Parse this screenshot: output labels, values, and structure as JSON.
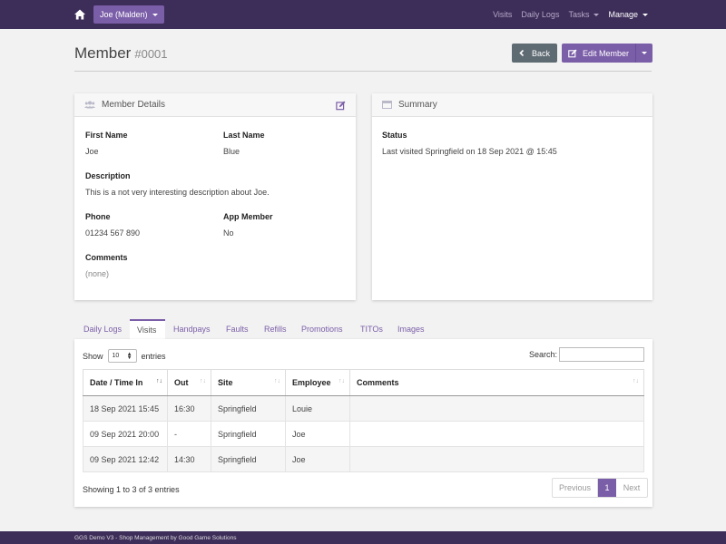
{
  "navbar": {
    "store_label": "Joe (Malden)",
    "links": [
      {
        "label": "Visits"
      },
      {
        "label": "Daily Logs"
      },
      {
        "label": "Tasks"
      },
      {
        "label": "Manage"
      }
    ]
  },
  "header": {
    "title": "Member",
    "id": "#0001",
    "back_label": "Back",
    "edit_label": "Edit Member"
  },
  "member_details": {
    "title": "Member Details",
    "first_name_label": "First Name",
    "first_name": "Joe",
    "last_name_label": "Last Name",
    "last_name": "Blue",
    "description_label": "Description",
    "description": "This is a not very interesting description about Joe.",
    "phone_label": "Phone",
    "phone": "01234 567 890",
    "app_member_label": "App Member",
    "app_member": "No",
    "comments_label": "Comments",
    "comments": "(none)"
  },
  "summary": {
    "title": "Summary",
    "status_label": "Status",
    "status": "Last visited Springfield on 18 Sep 2021 @ 15:45"
  },
  "tabs": [
    "Daily Logs",
    "Visits",
    "Handpays",
    "Faults",
    "Refills",
    "Promotions",
    "TITOs",
    "Images"
  ],
  "table": {
    "show_label": "Show",
    "show_value": "10",
    "entries_label": "entries",
    "search_label": "Search:",
    "columns": [
      "Date / Time In",
      "Out",
      "Site",
      "Employee",
      "Comments"
    ],
    "rows": [
      [
        "18 Sep 2021 15:45",
        "16:30",
        "Springfield",
        "Louie",
        ""
      ],
      [
        "09 Sep 2021 20:00",
        "-",
        "Springfield",
        "Joe",
        ""
      ],
      [
        "09 Sep 2021 12:42",
        "14:30",
        "Springfield",
        "Joe",
        ""
      ]
    ],
    "showing": "Showing 1 to 3 of 3 entries",
    "prev_label": "Previous",
    "page": "1",
    "next_label": "Next"
  },
  "footer": {
    "text": "GGS Demo V3 - Shop Management by Good Game Solutions"
  },
  "colors": {
    "navbar": "#3d2d59",
    "accent": "#7b5ea8",
    "back_button": "#5f6b73"
  }
}
